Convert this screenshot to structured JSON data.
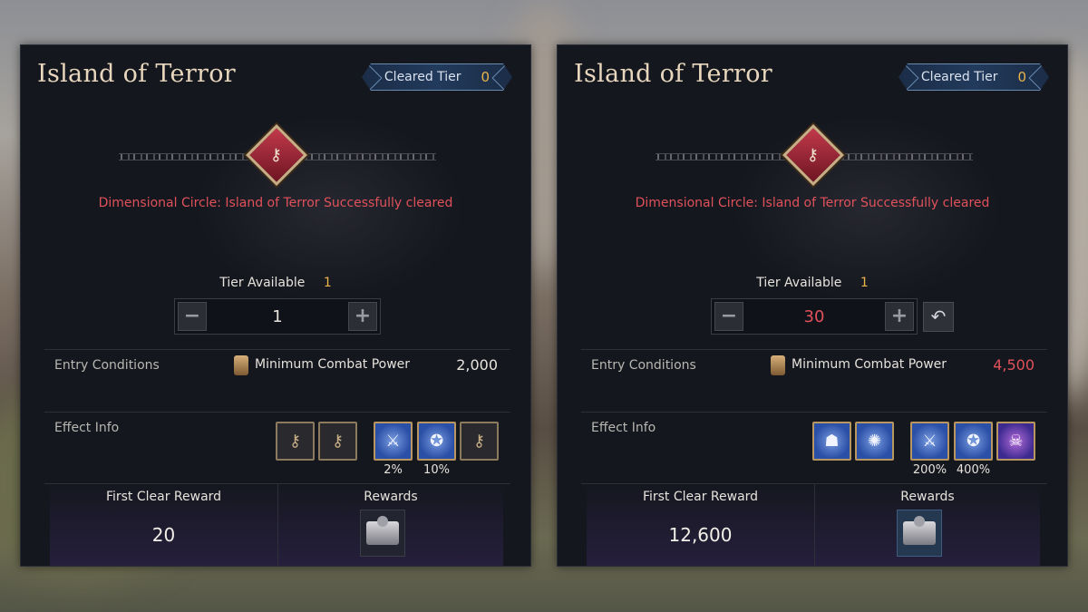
{
  "panels": [
    {
      "title": "Island of Terror",
      "cleared_tier_label": "Cleared Tier",
      "cleared_tier_value": "0",
      "status_message": "Dimensional Circle: Island of Terror Successfully cleared",
      "tier_available_label": "Tier Available",
      "tier_available_value": "1",
      "stepper": {
        "minus": "−",
        "plus": "+",
        "value": "1"
      },
      "entry_conditions_label": "Entry Conditions",
      "min_power_label": "Minimum Combat Power",
      "min_power_value": "2,000",
      "effect_info_label": "Effect Info",
      "effects": [
        {
          "icon": "lock-icon",
          "state": "locked",
          "percent": ""
        },
        {
          "icon": "lock-icon",
          "state": "locked",
          "percent": ""
        },
        {
          "icon": "crossed-swords-icon",
          "state": "active",
          "percent": "2%"
        },
        {
          "icon": "strongman-icon",
          "state": "active",
          "percent": "10%"
        },
        {
          "icon": "lock-icon",
          "state": "locked",
          "percent": ""
        }
      ],
      "first_clear_reward_label": "First Clear Reward",
      "first_clear_reward_value": "20",
      "rewards_label": "Rewards",
      "reward_item": "treasure-chest-icon"
    },
    {
      "title": "Island of Terror",
      "cleared_tier_label": "Cleared Tier",
      "cleared_tier_value": "0",
      "status_message": "Dimensional Circle: Island of Terror Successfully cleared",
      "tier_available_label": "Tier Available",
      "tier_available_value": "1",
      "stepper": {
        "minus": "−",
        "plus": "+",
        "value": "30"
      },
      "reset_icon": "undo-icon",
      "entry_conditions_label": "Entry Conditions",
      "min_power_label": "Minimum Combat Power",
      "min_power_value": "4,500",
      "effect_info_label": "Effect Info",
      "effects": [
        {
          "icon": "shadow-figure-icon",
          "state": "active",
          "percent": ""
        },
        {
          "icon": "spin-attack-icon",
          "state": "active",
          "percent": ""
        },
        {
          "icon": "crossed-swords-icon",
          "state": "active",
          "percent": "200%"
        },
        {
          "icon": "strongman-icon",
          "state": "active",
          "percent": "400%"
        },
        {
          "icon": "demon-skull-icon",
          "state": "purple",
          "percent": ""
        }
      ],
      "first_clear_reward_label": "First Clear Reward",
      "first_clear_reward_value": "12,600",
      "rewards_label": "Rewards",
      "reward_item": "treasure-chest-icon"
    }
  ],
  "colors": {
    "accent_gold": "#e9b44c",
    "alert_red": "#e0515a",
    "panel_bg": "#15171f",
    "badge_blue": "#223a5c"
  }
}
